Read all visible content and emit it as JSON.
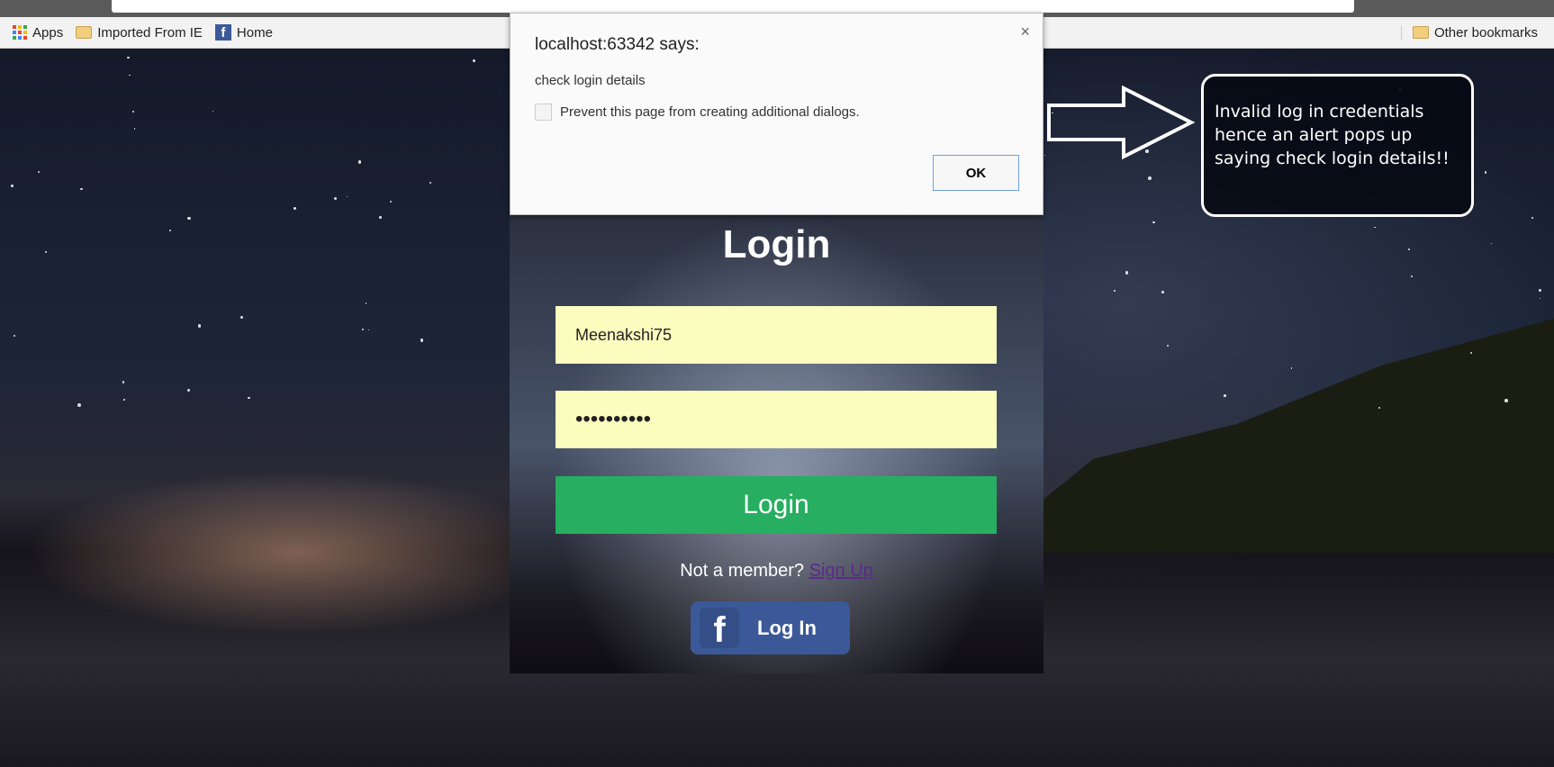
{
  "browser": {
    "bookmarks": [
      {
        "label": "Apps",
        "icon": "apps-grid-icon"
      },
      {
        "label": "Imported From IE",
        "icon": "folder-icon"
      },
      {
        "label": "Home",
        "icon": "facebook-icon"
      }
    ],
    "other_bookmarks": "Other bookmarks"
  },
  "dialog": {
    "title": "localhost:63342 says:",
    "message": "check login details",
    "checkbox_label": "Prevent this page from creating additional dialogs.",
    "checkbox_checked": false,
    "ok_label": "OK",
    "close_symbol": "×"
  },
  "login": {
    "title": "Login",
    "username_value": "Meenakshi75",
    "password_value": "••••••••••",
    "button_label": "Login",
    "not_member": "Not a member?",
    "signup_label": "Sign Up",
    "fb_label": "Log In",
    "fb_glyph": "f"
  },
  "annotation": {
    "text": "Invalid log in credentials hence an alert pops up saying check login details!!"
  },
  "colors": {
    "login_button": "#27ae60",
    "input_bg": "#fbfdbf",
    "facebook": "#3b5998",
    "signup_link": "#5b2a8f"
  }
}
